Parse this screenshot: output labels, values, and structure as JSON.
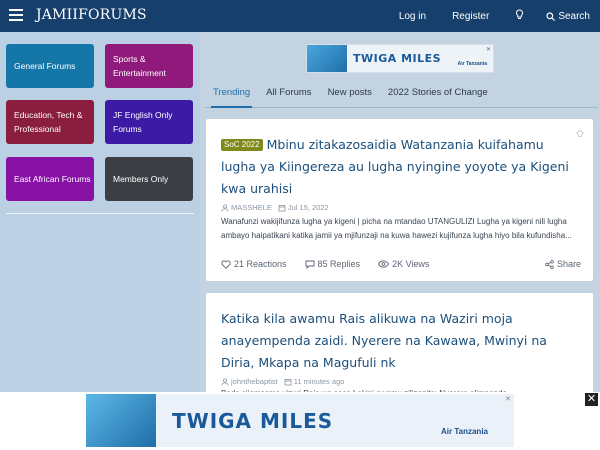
{
  "header": {
    "logo": "JAMIIFORUMS",
    "login": "Log in",
    "register": "Register",
    "search": "Search"
  },
  "sidebar": {
    "tiles": [
      {
        "label": "General Forums",
        "color": "#1577a8"
      },
      {
        "label": "Sports & Entertainment",
        "color": "#8f1a7c"
      },
      {
        "label": "Education, Tech & Professional",
        "color": "#8b1e3f"
      },
      {
        "label": "JF English Only Forums",
        "color": "#3c1aa5"
      },
      {
        "label": "East African Forums",
        "color": "#8711a5"
      },
      {
        "label": "Members Only",
        "color": "#3b3f45"
      }
    ]
  },
  "ads": {
    "top_title": "TWIGA MILES",
    "top_brand": "Air Tanzania",
    "bottom_title": "TWIGA MILES",
    "bottom_brand": "Air Tanzania"
  },
  "tabs": [
    "Trending",
    "All Forums",
    "New posts",
    "2022 Stories of Change"
  ],
  "threads": [
    {
      "prefix": "SoC 2022",
      "title": "Mbinu zitakazosaidia Watanzania kuifahamu lugha ya Kiingereza au lugha nyingine yoyote ya Kigeni kwa urahisi",
      "author": "MASSHELE",
      "date": "Jul 15, 2022",
      "snippet": "Wanafunzi wakijifunza lugha ya kigeni | picha na mtandao UTANGULIZI Lugha ya kigeni nili lugha ambayo haipatikani katika jamii ya mjifunzaji na kuwa hawezi kujifunza lugha hiyo bila kufundisha...",
      "reactions": "21 Reactions",
      "replies": "85 Replies",
      "views": "2K Views",
      "share": "Share"
    },
    {
      "title": "Katika kila awamu Rais alikuwa na Waziri moja anayempenda zaidi. Nyerere na Kawawa, Mwinyi na Diria, Mkapa na Magufuli nk",
      "author": "johnthebaptist",
      "date": "11 minutes ago",
      "snippet": "Bado sijamsoma vizuri Rais wa sasa Lakini awamu zilizopita: Nyerere alimpenda"
    }
  ],
  "colors": {
    "header_bg": "#163f6b",
    "accent": "#1f6ea8",
    "prefix_bg": "#7f8a1a"
  }
}
